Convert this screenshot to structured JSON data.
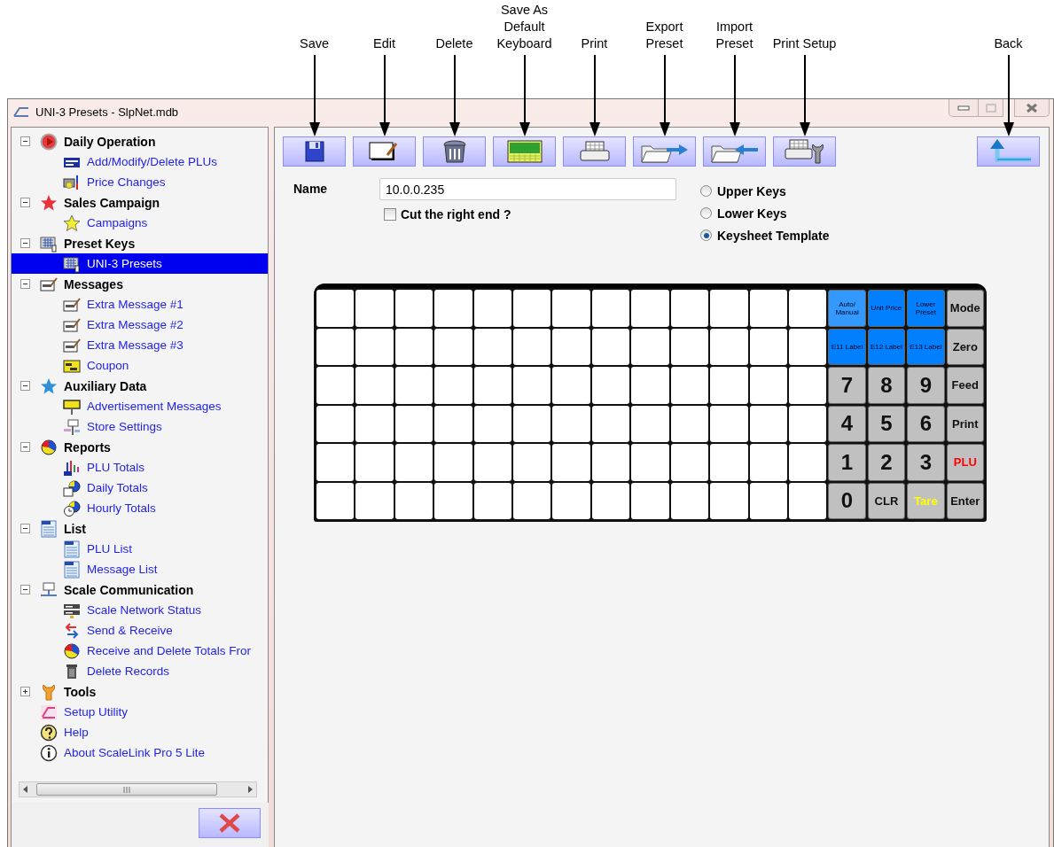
{
  "window": {
    "title": "UNI-3 Presets - SlpNet.mdb"
  },
  "sidebar": {
    "items": [
      {
        "label": "Daily Operation",
        "expanded": true,
        "selected": false,
        "children": [
          {
            "label": "Add/Modify/Delete PLUs",
            "selected": false
          },
          {
            "label": "Price Changes",
            "selected": false
          }
        ]
      },
      {
        "label": "Sales Campaign",
        "expanded": true,
        "selected": false,
        "children": [
          {
            "label": "Campaigns",
            "selected": false
          }
        ]
      },
      {
        "label": "Preset Keys",
        "expanded": true,
        "selected": false,
        "children": [
          {
            "label": "UNI-3 Presets",
            "selected": true
          }
        ]
      },
      {
        "label": "Messages",
        "expanded": true,
        "selected": false,
        "children": [
          {
            "label": "Extra Message #1",
            "selected": false
          },
          {
            "label": "Extra Message #2",
            "selected": false
          },
          {
            "label": "Extra Message #3",
            "selected": false
          },
          {
            "label": "Coupon",
            "selected": false
          }
        ]
      },
      {
        "label": "Auxiliary Data",
        "expanded": true,
        "selected": false,
        "children": [
          {
            "label": "Advertisement Messages",
            "selected": false
          },
          {
            "label": "Store Settings",
            "selected": false
          }
        ]
      },
      {
        "label": "Reports",
        "expanded": true,
        "selected": false,
        "children": [
          {
            "label": "PLU Totals",
            "selected": false
          },
          {
            "label": "Daily Totals",
            "selected": false
          },
          {
            "label": "Hourly Totals",
            "selected": false
          }
        ]
      },
      {
        "label": "List",
        "expanded": true,
        "selected": false,
        "children": [
          {
            "label": "PLU List",
            "selected": false
          },
          {
            "label": "Message List",
            "selected": false
          }
        ]
      },
      {
        "label": "Scale Communication",
        "expanded": true,
        "selected": false,
        "children": [
          {
            "label": "Scale Network Status",
            "selected": false
          },
          {
            "label": "Send & Receive",
            "selected": false
          },
          {
            "label": "Receive and Delete Totals Fror",
            "selected": false
          },
          {
            "label": "Delete Records",
            "selected": false
          }
        ]
      },
      {
        "label": "Tools",
        "expanded": false,
        "selected": false
      },
      {
        "label": "Setup Utility",
        "selected": false
      },
      {
        "label": "Help",
        "selected": false
      },
      {
        "label": "About ScaleLink Pro 5 Lite",
        "selected": false
      }
    ]
  },
  "toolbar": {
    "buttons": [
      {
        "callout": "Save"
      },
      {
        "callout": "Edit"
      },
      {
        "callout": "Delete"
      },
      {
        "callout": "Save As Default Keyboard"
      },
      {
        "callout": "Print"
      },
      {
        "callout": "Export Preset"
      },
      {
        "callout": "Import Preset"
      },
      {
        "callout": "Print Setup"
      }
    ],
    "back": {
      "callout": "Back"
    }
  },
  "form": {
    "name_label": "Name",
    "name_value": "10.0.0.235",
    "cut_right_end": {
      "label": "Cut the right end ?",
      "checked": false
    },
    "key_sets": [
      {
        "label": "Upper Keys",
        "selected": false
      },
      {
        "label": "Lower Keys",
        "selected": false
      },
      {
        "label": "Keysheet Template",
        "selected": true
      }
    ]
  },
  "keysheet": {
    "keys": [
      {
        "kind": "preset",
        "label": "Auto/ Manual",
        "color": "#3399ff"
      },
      {
        "kind": "preset",
        "label": "Unit Price",
        "color": "#0080ff"
      },
      {
        "kind": "preset",
        "label": "Lower Preset",
        "color": "#0080ff"
      },
      {
        "kind": "command",
        "label": "Mode",
        "color": "#c0c0c0"
      },
      {
        "kind": "preset",
        "label": "E11 Label",
        "color": "#0080ff"
      },
      {
        "kind": "preset",
        "label": "E12 Label",
        "color": "#0080ff"
      },
      {
        "kind": "preset",
        "label": "E13 Label",
        "color": "#0080ff"
      },
      {
        "kind": "command",
        "label": "Zero",
        "color": "#c0c0c0"
      },
      {
        "kind": "digit",
        "label": "7",
        "color": "#c0c0c0"
      },
      {
        "kind": "digit",
        "label": "8",
        "color": "#c0c0c0"
      },
      {
        "kind": "digit",
        "label": "9",
        "color": "#c0c0c0"
      },
      {
        "kind": "command",
        "label": "Feed",
        "color": "#c0c0c0"
      },
      {
        "kind": "digit",
        "label": "4",
        "color": "#c0c0c0"
      },
      {
        "kind": "digit",
        "label": "5",
        "color": "#c0c0c0"
      },
      {
        "kind": "digit",
        "label": "6",
        "color": "#c0c0c0"
      },
      {
        "kind": "command",
        "label": "Print",
        "color": "#c0c0c0"
      },
      {
        "kind": "digit",
        "label": "1",
        "color": "#c0c0c0"
      },
      {
        "kind": "digit",
        "label": "2",
        "color": "#c0c0c0"
      },
      {
        "kind": "digit",
        "label": "3",
        "color": "#c0c0c0"
      },
      {
        "kind": "command",
        "label": "PLU",
        "color": "#c0c0c0"
      },
      {
        "kind": "digit",
        "label": "0",
        "color": "#c0c0c0"
      },
      {
        "kind": "command",
        "label": "CLR",
        "color": "#c0c0c0"
      },
      {
        "kind": "command",
        "label": "Tare",
        "color": "#c0c0c0"
      },
      {
        "kind": "command",
        "label": "Enter",
        "color": "#c0c0c0"
      }
    ]
  }
}
